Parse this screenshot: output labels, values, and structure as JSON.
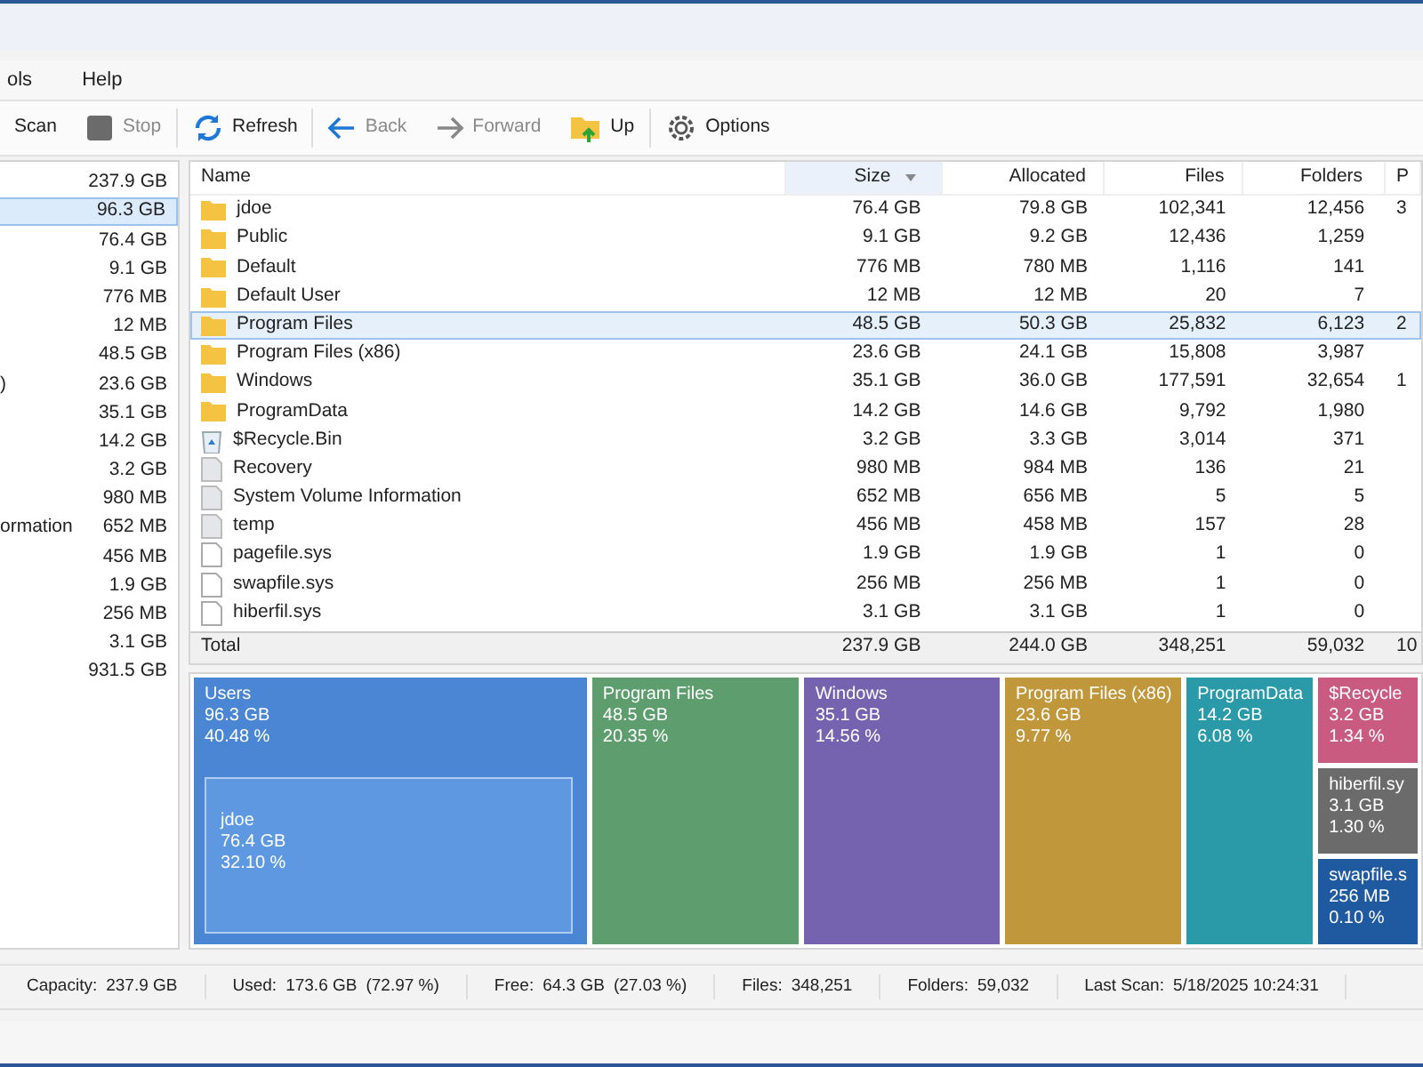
{
  "menu": [
    {
      "label": "ols"
    },
    {
      "label": "Help"
    }
  ],
  "toolbar": [
    {
      "label": "Scan",
      "kind": "none",
      "disabled": false
    },
    {
      "label": "Stop",
      "kind": "stop",
      "disabled": true
    },
    {
      "label": "Refresh",
      "kind": "refresh",
      "disabled": false
    },
    {
      "label": "Back",
      "kind": "back",
      "disabled": true
    },
    {
      "label": "Forward",
      "kind": "forward",
      "disabled": true
    },
    {
      "label": "Up",
      "kind": "up",
      "disabled": false
    },
    {
      "label": "Options",
      "kind": "gear",
      "disabled": false
    }
  ],
  "tree": [
    {
      "size": "237.9 GB",
      "selected": false
    },
    {
      "size": "96.3 GB",
      "selected": true
    },
    {
      "size": "76.4 GB",
      "selected": false
    },
    {
      "size": "9.1 GB",
      "selected": false
    },
    {
      "size": "776 MB",
      "selected": false
    },
    {
      "size": "12 MB",
      "selected": false
    },
    {
      "size": "48.5 GB",
      "selected": false
    },
    {
      "label": ")",
      "size": "23.6 GB",
      "selected": false
    },
    {
      "size": "35.1 GB",
      "selected": false
    },
    {
      "size": "14.2 GB",
      "selected": false
    },
    {
      "size": "3.2 GB",
      "selected": false
    },
    {
      "size": "980 MB",
      "selected": false
    },
    {
      "label": "ormation",
      "size": "652 MB",
      "selected": false
    },
    {
      "size": "456 MB",
      "selected": false
    },
    {
      "size": "1.9 GB",
      "selected": false
    },
    {
      "size": "256 MB",
      "selected": false
    },
    {
      "size": "3.1 GB",
      "selected": false
    },
    {
      "size": "931.5 GB",
      "selected": false
    }
  ],
  "table": {
    "columns": [
      {
        "label": "Name",
        "sorted": false
      },
      {
        "label": "Size",
        "sorted": true
      },
      {
        "label": "Allocated",
        "sorted": false
      },
      {
        "label": "Files",
        "sorted": false
      },
      {
        "label": "Folders",
        "sorted": false
      },
      {
        "label": "P",
        "sorted": false
      }
    ],
    "rows": [
      {
        "kind": "folder",
        "selected": false,
        "cells": [
          "jdoe",
          "76.4 GB",
          "79.8 GB",
          "102,341",
          "12,456",
          "3"
        ]
      },
      {
        "kind": "folder",
        "selected": false,
        "cells": [
          "Public",
          "9.1 GB",
          "9.2 GB",
          "12,436",
          "1,259",
          ""
        ]
      },
      {
        "kind": "folder",
        "selected": false,
        "cells": [
          "Default",
          "776 MB",
          "780 MB",
          "1,116",
          "141",
          ""
        ]
      },
      {
        "kind": "folder",
        "selected": false,
        "cells": [
          "Default User",
          "12 MB",
          "12 MB",
          "20",
          "7",
          ""
        ]
      },
      {
        "kind": "folder",
        "selected": true,
        "cells": [
          "Program Files",
          "48.5 GB",
          "50.3 GB",
          "25,832",
          "6,123",
          "2"
        ]
      },
      {
        "kind": "folder",
        "selected": false,
        "cells": [
          "Program Files (x86)",
          "23.6 GB",
          "24.1 GB",
          "15,808",
          "3,987",
          ""
        ]
      },
      {
        "kind": "folder",
        "selected": false,
        "cells": [
          "Windows",
          "35.1 GB",
          "36.0 GB",
          "177,591",
          "32,654",
          "1"
        ]
      },
      {
        "kind": "folder",
        "selected": false,
        "cells": [
          "ProgramData",
          "14.2 GB",
          "14.6 GB",
          "9,792",
          "1,980",
          ""
        ]
      },
      {
        "kind": "recycle",
        "selected": false,
        "cells": [
          "$Recycle.Bin",
          "3.2 GB",
          "3.3 GB",
          "3,014",
          "371",
          ""
        ]
      },
      {
        "kind": "system",
        "selected": false,
        "cells": [
          "Recovery",
          "980 MB",
          "984 MB",
          "136",
          "21",
          ""
        ]
      },
      {
        "kind": "system",
        "selected": false,
        "cells": [
          "System Volume Information",
          "652 MB",
          "656 MB",
          "5",
          "5",
          ""
        ]
      },
      {
        "kind": "system",
        "selected": false,
        "cells": [
          "temp",
          "456 MB",
          "458 MB",
          "157",
          "28",
          ""
        ]
      },
      {
        "kind": "file",
        "selected": false,
        "cells": [
          "pagefile.sys",
          "1.9 GB",
          "1.9 GB",
          "1",
          "0",
          ""
        ]
      },
      {
        "kind": "file",
        "selected": false,
        "cells": [
          "swapfile.sys",
          "256 MB",
          "256 MB",
          "1",
          "0",
          ""
        ]
      },
      {
        "kind": "file",
        "selected": false,
        "cells": [
          "hiberfil.sys",
          "3.1 GB",
          "3.1 GB",
          "1",
          "0",
          ""
        ]
      }
    ],
    "total": [
      "Total",
      "237.9 GB",
      "244.0 GB",
      "348,251",
      "59,032",
      "10"
    ]
  },
  "treemap": [
    {
      "name": "Users",
      "size": "96.3 GB",
      "percent": "40.48 %",
      "color": "#4a86d4",
      "children": [
        {
          "name": "jdoe",
          "size": "76.4 GB",
          "percent": "32.10 %",
          "color": "#5d98e0"
        }
      ]
    },
    {
      "name": "Program Files",
      "size": "48.5 GB",
      "percent": "20.35 %",
      "color": "#5e9e6e"
    },
    {
      "name": "Windows",
      "size": "35.1 GB",
      "percent": "14.56 %",
      "color": "#7563b0"
    },
    {
      "name": "Program Files (x86)",
      "size": "23.6 GB",
      "percent": "9.77 %",
      "color": "#c0973a"
    },
    {
      "name": "ProgramData",
      "size": "14.2 GB",
      "percent": "6.08 %",
      "color": "#2a9aa8"
    },
    {
      "name": "$Recycle",
      "size": "3.2 GB",
      "percent": "1.34 %",
      "color": "#c95b80"
    },
    {
      "name": "hiberfil.sy",
      "size": "3.1 GB",
      "percent": "1.30 %",
      "color": "#6b6b6b"
    },
    {
      "name": "swapfile.s",
      "size": "256 MB",
      "percent": "0.10 %",
      "color": "#1f5aa0"
    }
  ],
  "status_bar": [
    {
      "label": "Capacity:",
      "value": "237.9 GB"
    },
    {
      "label": "Used:",
      "value": "173.6 GB",
      "detail": "(72.97 %)"
    },
    {
      "label": "Free:",
      "value": "64.3 GB",
      "detail": "(27.03 %)"
    },
    {
      "label": "Files:",
      "value": "348,251"
    },
    {
      "label": "Folders:",
      "value": "59,032"
    },
    {
      "label": "Last Scan:",
      "value": "5/18/2025 10:24:31"
    }
  ]
}
